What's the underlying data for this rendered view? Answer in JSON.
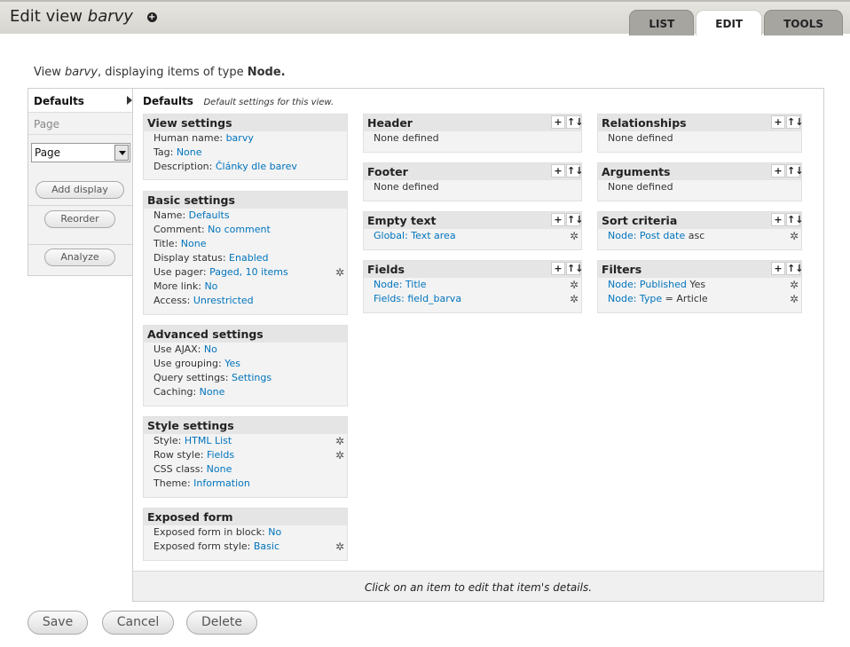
{
  "header": {
    "title_prefix": "Edit view",
    "view_name": "barvy",
    "add_icon": "plus-circle-icon",
    "tabs": [
      {
        "label": "LIST",
        "active": false
      },
      {
        "label": "EDIT",
        "active": true
      },
      {
        "label": "TOOLS",
        "active": false
      }
    ]
  },
  "intro": {
    "prefix": "View",
    "view_name": "barvy",
    "middle": ", displaying items of type",
    "type": "Node."
  },
  "left_nav": {
    "defaults_label": "Defaults",
    "page_label": "Page",
    "display_select_value": "Page",
    "add_display_label": "Add display",
    "reorder_label": "Reorder",
    "analyze_label": "Analyze"
  },
  "defaults_header": {
    "title": "Defaults",
    "subtitle": "Default settings for this view."
  },
  "view_settings": {
    "title": "View settings",
    "rows": [
      {
        "label": "Human name: ",
        "value": "barvy"
      },
      {
        "label": "Tag: ",
        "value": "None"
      },
      {
        "label": "Description: ",
        "value": "Články dle barev"
      }
    ]
  },
  "basic_settings": {
    "title": "Basic settings",
    "rows": [
      {
        "label": "Name: ",
        "value": "Defaults"
      },
      {
        "label": "Comment: ",
        "value": "No comment"
      },
      {
        "label": "Title: ",
        "value": "None"
      },
      {
        "label": "Display status: ",
        "value": "Enabled"
      },
      {
        "label": "Use pager: ",
        "value": "Paged, 10 items"
      },
      {
        "label": "More link: ",
        "value": "No"
      },
      {
        "label": "Access: ",
        "value": "Unrestricted"
      }
    ]
  },
  "advanced_settings": {
    "title": "Advanced settings",
    "rows": [
      {
        "label": "Use AJAX: ",
        "value": "No"
      },
      {
        "label": "Use grouping: ",
        "value": "Yes"
      },
      {
        "label": "Query settings: ",
        "value": "Settings"
      },
      {
        "label": "Caching: ",
        "value": "None"
      }
    ]
  },
  "style_settings": {
    "title": "Style settings",
    "rows": [
      {
        "label": "Style: ",
        "value": "HTML List"
      },
      {
        "label": "Row style: ",
        "value": "Fields"
      },
      {
        "label": "CSS class: ",
        "value": "None"
      },
      {
        "label": "Theme: ",
        "value": "Information"
      }
    ]
  },
  "exposed_form": {
    "title": "Exposed form",
    "rows": [
      {
        "label": "Exposed form in block: ",
        "value": "No"
      },
      {
        "label": "Exposed form style: ",
        "value": "Basic"
      }
    ]
  },
  "header_section": {
    "title": "Header",
    "empty": "None defined"
  },
  "footer_section": {
    "title": "Footer",
    "empty": "None defined"
  },
  "empty_text_section": {
    "title": "Empty text",
    "item": "Global: Text area"
  },
  "fields_section": {
    "title": "Fields",
    "items": [
      "Node: Title",
      "Fields: field_barva"
    ]
  },
  "relationships_section": {
    "title": "Relationships",
    "empty": "None defined"
  },
  "arguments_section": {
    "title": "Arguments",
    "empty": "None defined"
  },
  "sort_section": {
    "title": "Sort criteria",
    "item_link": "Node: Post date",
    "item_suffix": " asc"
  },
  "filters_section": {
    "title": "Filters",
    "items": [
      {
        "link": "Node: Published",
        "suffix": " Yes"
      },
      {
        "link": "Node: Type",
        "suffix": " = Article"
      }
    ]
  },
  "section_buttons": {
    "add": "+",
    "rearrange": "↑↓"
  },
  "gear_glyph": "✲",
  "status_bar": "Click on an item to edit that item's details.",
  "actions": {
    "save": "Save",
    "cancel": "Cancel",
    "delete": "Delete"
  }
}
